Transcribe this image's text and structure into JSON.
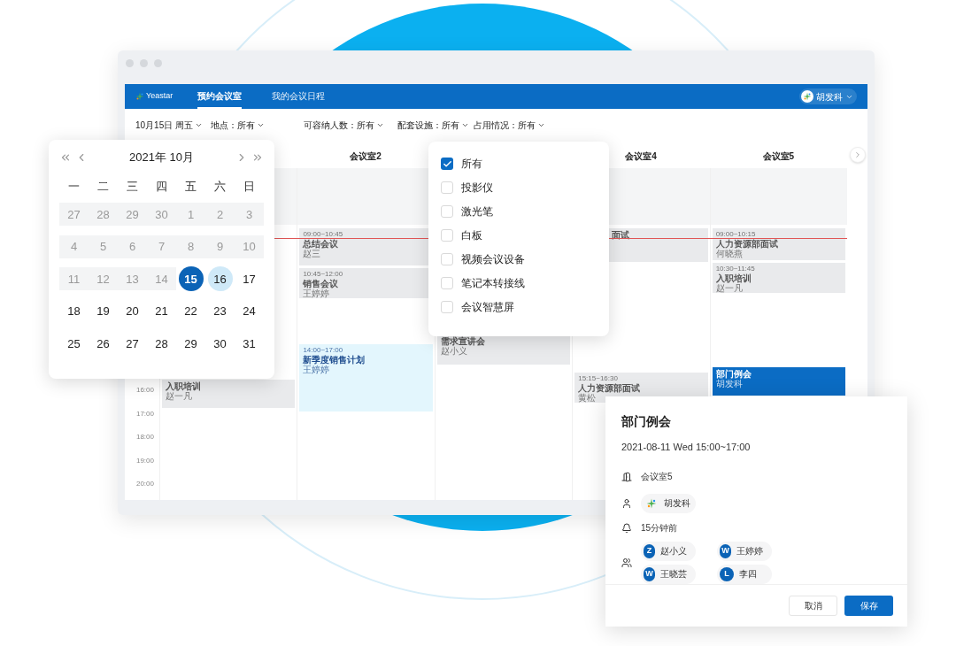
{
  "nav": {
    "logo": "Yeastar",
    "tabs": [
      {
        "label": "预约会议室",
        "selected": true
      },
      {
        "label": "我的会议日程",
        "selected": false
      }
    ],
    "user": "胡发科"
  },
  "filters": [
    "10月15日 周五",
    "地点：所有",
    "可容纳人数：所有",
    "配套设施：所有",
    "占用情况：所有"
  ],
  "columns": [
    {
      "events": [
        {
          "kind": "booked",
          "title": "入职培训",
          "host": "赵一凡"
        }
      ]
    },
    {
      "header": "会议室2",
      "events": [
        {
          "kind": "booked",
          "time": "09:00~10:45",
          "title": "总结会议",
          "host": "赵三"
        },
        {
          "kind": "booked",
          "time": "10:45~12:00",
          "title": "销售会议",
          "host": "王婷婷"
        },
        {
          "kind": "selected",
          "time": "14:00~17:00",
          "title": "新季度销售计划",
          "host": "王婷婷"
        }
      ]
    },
    {
      "events": [
        {
          "kind": "booked",
          "title": "需求宣讲会",
          "host": "赵小义"
        }
      ]
    },
    {
      "header": "会议室4",
      "events": [
        {
          "kind": "booked",
          "title": "面试"
        },
        {
          "kind": "booked",
          "time": "15:15~16:30",
          "title": "人力资源部面试",
          "host": "黄松"
        }
      ]
    },
    {
      "header": "会议室5",
      "events": [
        {
          "kind": "booked",
          "time": "09:00~10:15",
          "title": "人力资源部面试",
          "host": "何晓燕"
        },
        {
          "kind": "booked",
          "time": "10:30~11:45",
          "title": "入职培训",
          "host": "赵一凡"
        },
        {
          "kind": "active",
          "title": "部门例会",
          "host": "胡发科"
        }
      ]
    }
  ],
  "times": [
    "16:00",
    "17:00",
    "18:00",
    "19:00",
    "20:00"
  ],
  "calendar": {
    "title": "2021年 10月",
    "weekdays": [
      "一",
      "二",
      "三",
      "四",
      "五",
      "六",
      "日"
    ],
    "weeks": [
      [
        {
          "day": "27",
          "disabled": true,
          "selected": false,
          "hovered": false
        },
        {
          "day": "28",
          "disabled": true,
          "selected": false,
          "hovered": false
        },
        {
          "day": "29",
          "disabled": true,
          "selected": false,
          "hovered": false
        },
        {
          "day": "30",
          "disabled": true,
          "selected": false,
          "hovered": false
        },
        {
          "day": "1",
          "disabled": true,
          "selected": false,
          "hovered": false
        },
        {
          "day": "2",
          "disabled": true,
          "selected": false,
          "hovered": false
        },
        {
          "day": "3",
          "disabled": true,
          "selected": false,
          "hovered": false
        }
      ],
      [
        {
          "day": "4",
          "disabled": true,
          "selected": false,
          "hovered": false
        },
        {
          "day": "5",
          "disabled": true,
          "selected": false,
          "hovered": false
        },
        {
          "day": "6",
          "disabled": true,
          "selected": false,
          "hovered": false
        },
        {
          "day": "7",
          "disabled": true,
          "selected": false,
          "hovered": false
        },
        {
          "day": "8",
          "disabled": true,
          "selected": false,
          "hovered": false
        },
        {
          "day": "9",
          "disabled": true,
          "selected": false,
          "hovered": false
        },
        {
          "day": "10",
          "disabled": true,
          "selected": false,
          "hovered": false
        }
      ],
      [
        {
          "day": "11",
          "disabled": true,
          "selected": false,
          "hovered": false
        },
        {
          "day": "12",
          "disabled": true,
          "selected": false,
          "hovered": false
        },
        {
          "day": "13",
          "disabled": true,
          "selected": false,
          "hovered": false
        },
        {
          "day": "14",
          "disabled": true,
          "selected": false,
          "hovered": false
        },
        {
          "day": "15",
          "disabled": false,
          "selected": true,
          "hovered": false
        },
        {
          "day": "16",
          "disabled": false,
          "selected": false,
          "hovered": true
        },
        {
          "day": "17",
          "disabled": false,
          "selected": false,
          "hovered": false
        }
      ],
      [
        {
          "day": "18",
          "disabled": false,
          "selected": false,
          "hovered": false
        },
        {
          "day": "19",
          "disabled": false,
          "selected": false,
          "hovered": false
        },
        {
          "day": "20",
          "disabled": false,
          "selected": false,
          "hovered": false
        },
        {
          "day": "21",
          "disabled": false,
          "selected": false,
          "hovered": false
        },
        {
          "day": "22",
          "disabled": false,
          "selected": false,
          "hovered": false
        },
        {
          "day": "23",
          "disabled": false,
          "selected": false,
          "hovered": false
        },
        {
          "day": "24",
          "disabled": false,
          "selected": false,
          "hovered": false
        }
      ],
      [
        {
          "day": "25",
          "disabled": false,
          "selected": false,
          "hovered": false
        },
        {
          "day": "26",
          "disabled": false,
          "selected": false,
          "hovered": false
        },
        {
          "day": "27",
          "disabled": false,
          "selected": false,
          "hovered": false
        },
        {
          "day": "28",
          "disabled": false,
          "selected": false,
          "hovered": false
        },
        {
          "day": "29",
          "disabled": false,
          "selected": false,
          "hovered": false
        },
        {
          "day": "30",
          "disabled": false,
          "selected": false,
          "hovered": false
        },
        {
          "day": "31",
          "disabled": false,
          "selected": false,
          "hovered": false
        }
      ]
    ]
  },
  "facility_menu": [
    {
      "label": "所有",
      "checked": true
    },
    {
      "label": "投影仪",
      "checked": false
    },
    {
      "label": "激光笔",
      "checked": false
    },
    {
      "label": "白板",
      "checked": false
    },
    {
      "label": "视频会议设备",
      "checked": false
    },
    {
      "label": "笔记本转接线",
      "checked": false
    },
    {
      "label": "会议智慧屏",
      "checked": false
    }
  ],
  "event_detail": {
    "title": "部门例会",
    "when": "2021-08-11 Wed 15:00~17:00",
    "room": "会议室5",
    "organizer": "胡发科",
    "reminder": "15分钟前",
    "attendees": [
      {
        "initial": "Z",
        "name": "赵小义"
      },
      {
        "initial": "W",
        "name": "王婷婷"
      },
      {
        "initial": "W",
        "name": "王晓芸"
      },
      {
        "initial": "L",
        "name": "李四"
      }
    ],
    "buttons": [
      {
        "label": "取消",
        "kind": "secondary"
      },
      {
        "label": "保存",
        "kind": "primary"
      }
    ]
  }
}
